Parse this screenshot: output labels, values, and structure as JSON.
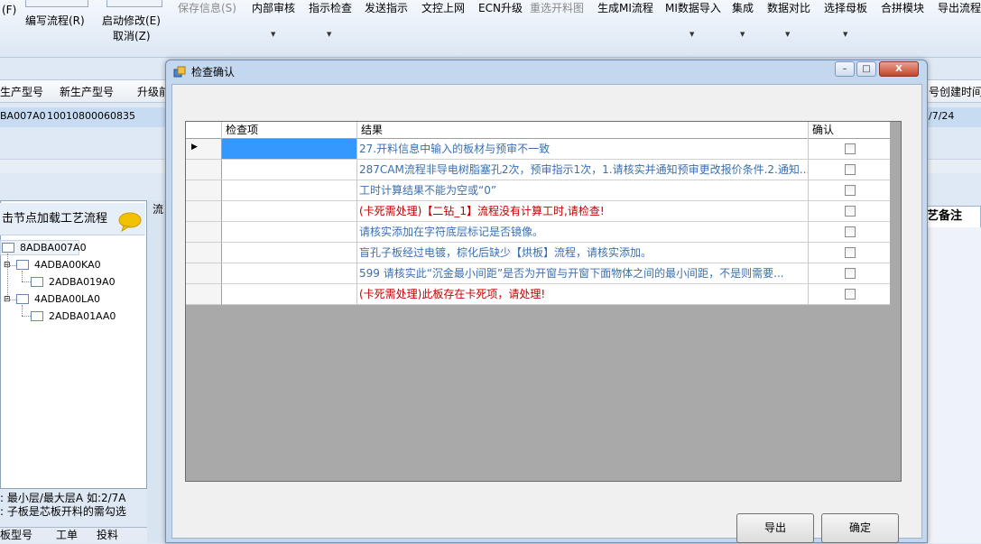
{
  "toolbar": {
    "items": [
      {
        "label": "(F)"
      },
      {
        "label": "编写流程(R)"
      },
      {
        "label": "启动修改(E)"
      },
      {
        "label": "取消(Z)"
      },
      {
        "label": "保存信息(S)"
      },
      {
        "label": "内部审核"
      },
      {
        "label": "指示检查"
      },
      {
        "label": "发送指示"
      },
      {
        "label": "文控上网"
      },
      {
        "label": "ECN升级"
      },
      {
        "label": "重选开料图"
      },
      {
        "label": "生成MI流程"
      },
      {
        "label": "MI数据导入"
      },
      {
        "label": "集成"
      },
      {
        "label": "数据对比"
      },
      {
        "label": "选择母板"
      },
      {
        "label": "合拼模块"
      },
      {
        "label": "导出流程"
      }
    ]
  },
  "background": {
    "grid_headers": [
      "生产型号",
      "新生产型号",
      "升级前",
      "号创建时间"
    ],
    "grid_row": [
      "BA007A0",
      "10010800060835",
      "/7/24"
    ],
    "tree_header": "击节点加载工艺流程",
    "tree_nodes": [
      "8ADBA007A0",
      "4ADBA00KA0",
      "2ADBA019A0",
      "4ADBA00LA0",
      "2ADBA01AA0"
    ],
    "panel_tab_left": "流",
    "panel_tab_right": "艺备注",
    "notes": [
      "最小层/最大层A 如:2/7A",
      "子板是芯板开料的需勾选"
    ],
    "notes_prefix": [
      ":",
      ":"
    ],
    "bottom_tabs": [
      "板型号",
      "工单",
      "投料"
    ]
  },
  "dialog": {
    "title": "检查确认",
    "window_buttons": {
      "minimize": "–",
      "maximize": "□",
      "close": "X"
    },
    "columns": [
      "检查项",
      "结果",
      "确认"
    ],
    "rows": [
      {
        "item": "",
        "result": "27.开料信息中输入的板材与预审不一致",
        "highlight": false,
        "selected": true
      },
      {
        "item": "",
        "result": "287CAM流程非导电树脂塞孔2次，预审指示1次，1.请核实并通知预审更改报价条件.2.通知...",
        "highlight": false,
        "selected": false
      },
      {
        "item": "",
        "result": "工时计算结果不能为空或“0”",
        "highlight": false,
        "selected": false
      },
      {
        "item": "",
        "result": "(卡死需处理)【二钻_1】流程没有计算工时,请检查!",
        "highlight": true,
        "selected": false
      },
      {
        "item": "",
        "result": "请核实添加在字符底层标记是否镜像。",
        "highlight": false,
        "selected": false
      },
      {
        "item": "",
        "result": "盲孔子板经过电镀，棕化后缺少【烘板】流程，请核实添加。",
        "highlight": false,
        "selected": false
      },
      {
        "item": "",
        "result": "599 请核实此“沉金最小间距”是否为开窗与开窗下面物体之间的最小间距，不是则需要...",
        "highlight": false,
        "selected": false
      },
      {
        "item": "",
        "result": "(卡死需处理)此板存在卡死项，请处理!",
        "highlight": true,
        "selected": false
      }
    ],
    "export_label": "导出",
    "ok_label": "确定",
    "row_indicator": "▶"
  },
  "colors": {
    "result_text": "#3a6fb0",
    "error_text": "#c00000",
    "selection": "#3399ff",
    "grid_background": "#a9a9a9"
  }
}
